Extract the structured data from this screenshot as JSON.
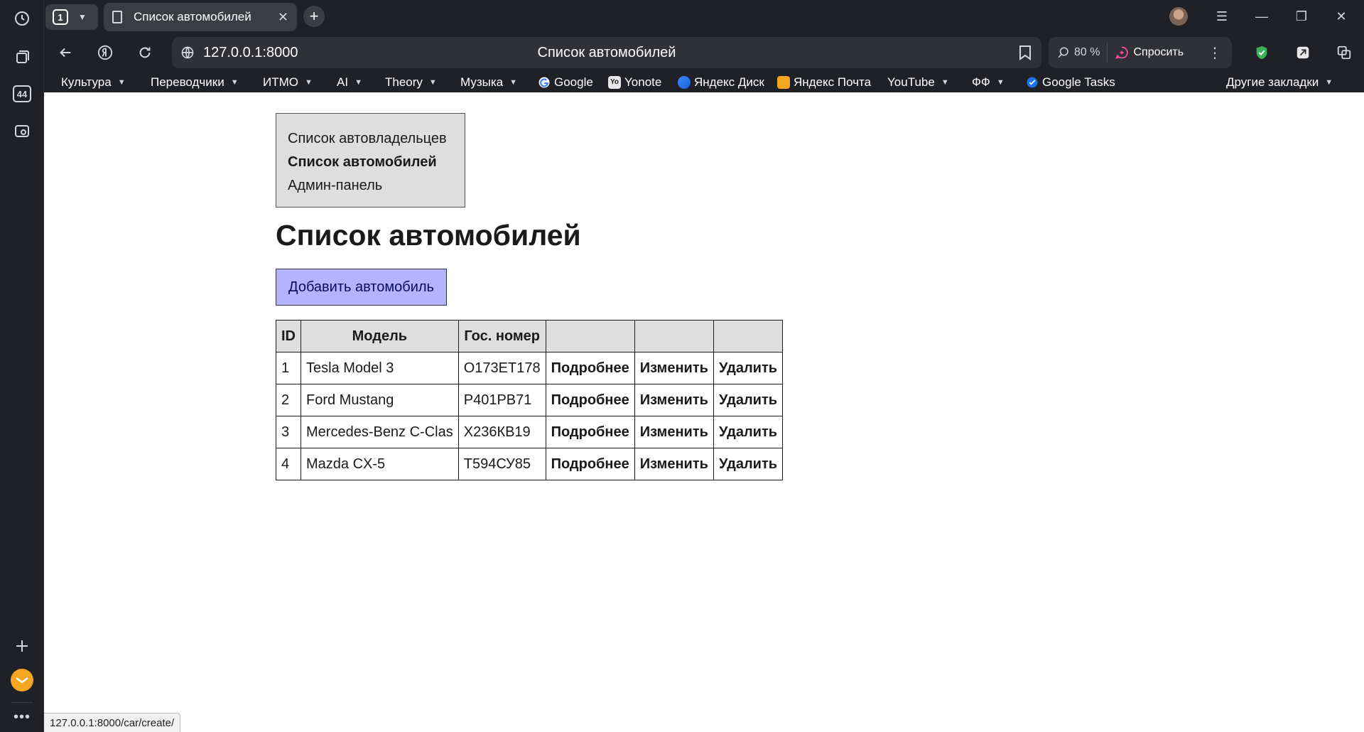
{
  "browser": {
    "tab_count": "1",
    "tab_title": "Список автомобилей",
    "url": "127.0.0.1:8000",
    "page_title": "Список автомобилей",
    "zoom": "80 %",
    "ask_label": "Спросить",
    "side_badge": "44"
  },
  "bookmarks": [
    {
      "label": "Культура",
      "folder": true
    },
    {
      "label": "Переводчики",
      "folder": true
    },
    {
      "label": "ИТМО",
      "folder": true
    },
    {
      "label": "AI",
      "folder": true
    },
    {
      "label": "Theory",
      "folder": true
    },
    {
      "label": "Музыка",
      "folder": true
    },
    {
      "label": "Google",
      "icon": "google-icon"
    },
    {
      "label": "Yonote",
      "icon": "yonote-icon"
    },
    {
      "label": "Яндекс Диск",
      "icon": "yandex-disk-icon"
    },
    {
      "label": "Яндекс Почта",
      "icon": "yandex-mail-icon"
    },
    {
      "label": "YouTube",
      "folder": true
    },
    {
      "label": "ФФ",
      "folder": true
    },
    {
      "label": "Google Tasks",
      "icon": "google-tasks-icon"
    },
    {
      "label": "Другие закладки",
      "folder": true
    }
  ],
  "site_nav": {
    "owners": "Список автовладельцев",
    "cars": "Список автомобилей",
    "admin": "Админ-панель"
  },
  "heading": "Список автомобилей",
  "add_button": "Добавить автомобиль",
  "table": {
    "headers": [
      "ID",
      "Модель",
      "Гос. номер",
      "",
      "",
      ""
    ],
    "rows": [
      {
        "id": "1",
        "model": "Tesla Model 3",
        "plate": "О173ЕТ178",
        "details": "Подробнее",
        "edit": "Изменить",
        "delete": "Удалить"
      },
      {
        "id": "2",
        "model": "Ford Mustang",
        "plate": "Р401РВ71",
        "details": "Подробнее",
        "edit": "Изменить",
        "delete": "Удалить"
      },
      {
        "id": "3",
        "model": "Mercedes-Benz C-Clas",
        "plate": "Х236КВ19",
        "details": "Подробнее",
        "edit": "Изменить",
        "delete": "Удалить"
      },
      {
        "id": "4",
        "model": "Mazda CX-5",
        "plate": "Т594СУ85",
        "details": "Подробнее",
        "edit": "Изменить",
        "delete": "Удалить"
      }
    ]
  },
  "status_url": "127.0.0.1:8000/car/create/",
  "colors": {
    "chrome_bg": "#1f2126",
    "omnibox_bg": "#2f3137",
    "nav_box_bg": "#dedede",
    "add_button_bg": "#b3b3ff",
    "shield_green": "#3bb15a",
    "mail_orange": "#f5a623"
  }
}
